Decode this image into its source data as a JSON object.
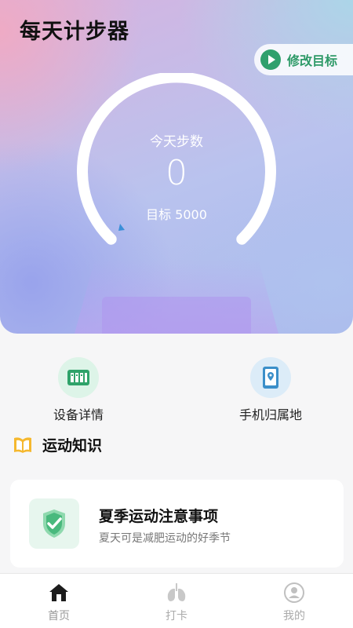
{
  "header": {
    "app_title": "每天计步器",
    "edit_goal_label": "修改目标"
  },
  "steps": {
    "today_label": "今天步数",
    "count": "0",
    "goal_line": "目标 5000",
    "goal": 5000,
    "progress_fraction": 0
  },
  "quick_actions": [
    {
      "label": "设备详情",
      "icon": "device-icon"
    },
    {
      "label": "手机归属地",
      "icon": "phone-location-icon"
    }
  ],
  "section": {
    "title": "运动知识",
    "icon": "book-icon"
  },
  "article": {
    "title": "夏季运动注意事项",
    "subtitle": "夏天可是减肥运动的好季节",
    "icon": "shield-check-icon"
  },
  "tabs": [
    {
      "label": "首页",
      "icon": "home-icon",
      "active": true
    },
    {
      "label": "打卡",
      "icon": "lungs-icon",
      "active": false
    },
    {
      "label": "我的",
      "icon": "user-icon",
      "active": false
    }
  ],
  "colors": {
    "accent_green": "#2fa06d",
    "title_text": "#111111",
    "gauge_marker": "#3a8fd8"
  }
}
